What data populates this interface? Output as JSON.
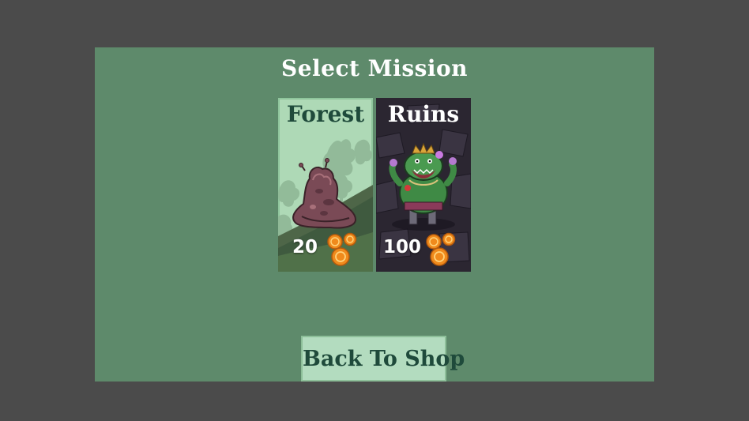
{
  "screen": {
    "title": "Select Mission"
  },
  "missions": [
    {
      "name": "Forest",
      "reward": "20",
      "enemy_icon": "slime-creature-icon",
      "reward_icon": "gold-coins-icon"
    },
    {
      "name": "Ruins",
      "reward": "100",
      "enemy_icon": "ogre-boss-icon",
      "reward_icon": "gold-coins-icon"
    }
  ],
  "actions": {
    "back_label": "Back To Shop"
  },
  "colors": {
    "background": "#4b4b4b",
    "panel": "#5e8a6b",
    "card_forest": "#aed9b6",
    "card_ruins": "#2a2530",
    "button": "#b3dcbf",
    "dark_text": "#1f4a3b",
    "coin": "#f08a1c"
  }
}
